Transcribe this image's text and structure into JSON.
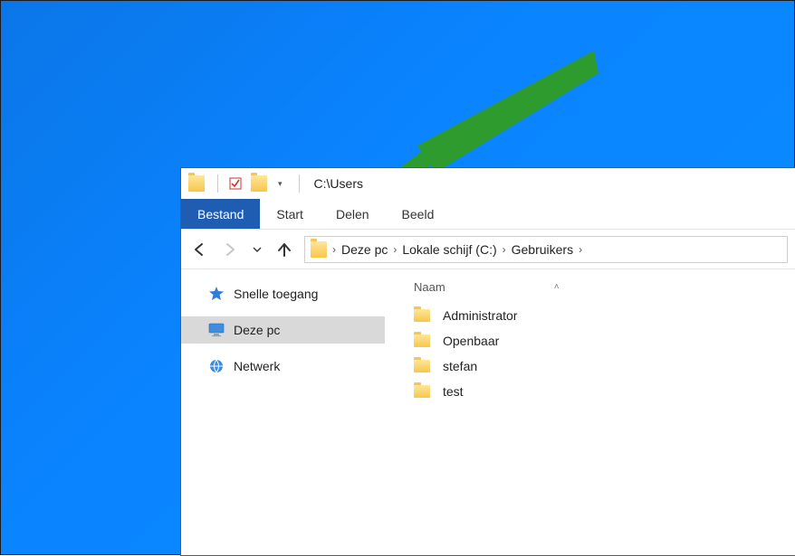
{
  "title": "C:\\Users",
  "ribbon": {
    "file": "Bestand",
    "tabs": [
      "Start",
      "Delen",
      "Beeld"
    ]
  },
  "breadcrumb": {
    "items": [
      "Deze pc",
      "Lokale schijf (C:)",
      "Gebruikers"
    ]
  },
  "sidebar": {
    "items": [
      {
        "label": "Snelle toegang",
        "icon": "star",
        "selected": false
      },
      {
        "label": "Deze pc",
        "icon": "monitor",
        "selected": true
      },
      {
        "label": "Netwerk",
        "icon": "network",
        "selected": false
      }
    ]
  },
  "columns": {
    "name": "Naam"
  },
  "files": [
    {
      "name": "Administrator"
    },
    {
      "name": "Openbaar"
    },
    {
      "name": "stefan"
    },
    {
      "name": "test"
    }
  ],
  "annotation": {
    "arrow_color": "#2e9b2e"
  }
}
